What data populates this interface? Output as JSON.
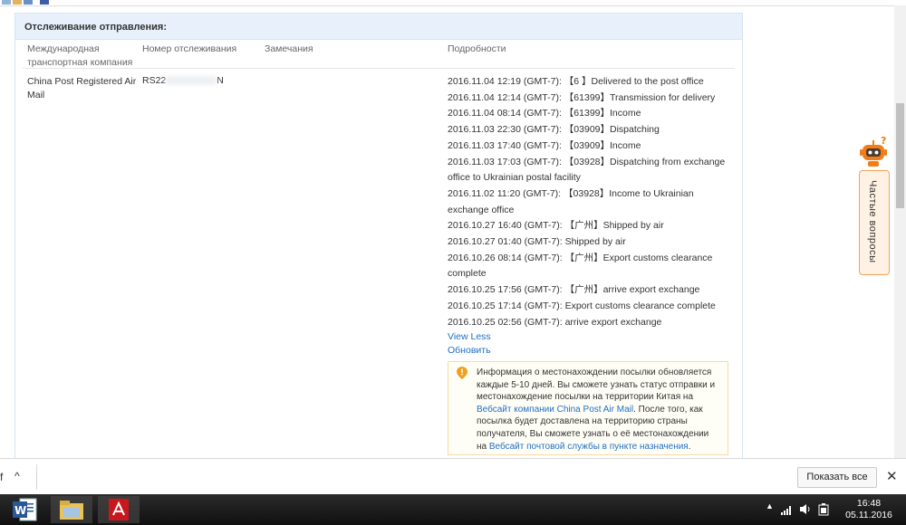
{
  "tracking": {
    "title": "Отслеживание отправления:",
    "columns": {
      "carrier": "Международная транспортная компания",
      "tracking_number": "Номер отслеживания",
      "remarks": "Замечания",
      "details": "Подробности"
    },
    "carrier_name": "China Post Registered Air Mail",
    "tracking_number_prefix": "RS22",
    "tracking_number_suffix": "N",
    "events": [
      "2016.11.04 12:19 (GMT-7): 【6      】Delivered to the post office",
      "2016.11.04 12:14 (GMT-7): 【61399】Transmission for delivery",
      "2016.11.04 08:14 (GMT-7): 【61399】Income",
      "2016.11.03 22:30 (GMT-7): 【03909】Dispatching",
      "2016.11.03 17:40 (GMT-7): 【03909】Income",
      "2016.11.03 17:03 (GMT-7): 【03928】Dispatching from exchange office to Ukrainian postal facility",
      "2016.11.02 11:20 (GMT-7): 【03928】Income to Ukrainian exchange office",
      "2016.10.27 16:40 (GMT-7): 【广州】Shipped by air",
      "2016.10.27 01:40 (GMT-7): Shipped by air",
      "2016.10.26 08:14 (GMT-7): 【广州】Export customs clearance complete",
      "2016.10.25 17:56 (GMT-7): 【广州】arrive export exchange",
      "2016.10.25 17:14 (GMT-7): Export customs clearance complete",
      "2016.10.25 02:56 (GMT-7): arrive export exchange"
    ],
    "view_less": "View Less",
    "refresh": "Обновить",
    "info": {
      "text_1": "Информация о местонахождении посылки обновляется каждые 5-10 дней. Вы сможете узнать статус отправки и местонахождение посылки на территории Китая на ",
      "link_1": "Вебсайт компании China Post Air Mail",
      "text_2": ". После того, как посылка будет доставлена на территорию страны получателя, Вы сможете узнать о её местонахождении на ",
      "link_2": "Вебсайт почтовой службы в пункте назначения",
      "text_3": "."
    }
  },
  "faq": {
    "label": "Частые вопросы"
  },
  "download_bar": {
    "file_fragment": "f",
    "show_all": "Показать все",
    "close": "✕",
    "expand": "^"
  },
  "taskbar": {
    "apps": [
      "word-icon",
      "file-explorer-icon",
      "pdf-reader-icon"
    ],
    "time": "16:48",
    "date": "05.11.2016"
  },
  "colors": {
    "accent": "#1f6fc5",
    "panel_header": "#e8f1fb",
    "faq_orange": "#f0a254",
    "info_border": "#f5dca3"
  }
}
